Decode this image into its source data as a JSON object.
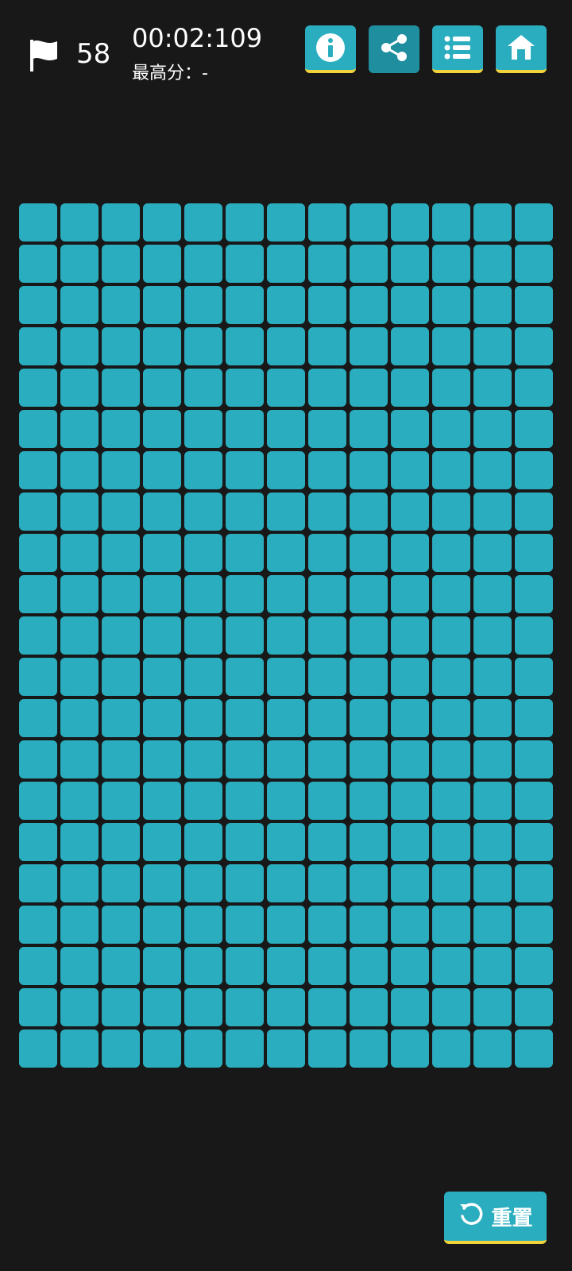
{
  "header": {
    "flag_count": "58",
    "timer": "00:02:109",
    "best_label": "最高分：",
    "best_value": "-"
  },
  "toolbar": {
    "buttons": [
      {
        "name": "info",
        "icon": "info-icon",
        "active": false
      },
      {
        "name": "share",
        "icon": "share-icon",
        "active": true
      },
      {
        "name": "list",
        "icon": "list-icon",
        "active": false
      },
      {
        "name": "home",
        "icon": "home-icon",
        "active": false
      }
    ]
  },
  "board": {
    "columns": 13,
    "rows": 21
  },
  "reset_button": {
    "label": "重置",
    "icon": "reset-icon"
  },
  "colors": {
    "background": "#181818",
    "tile": "#2aaebf",
    "tile_active": "#1f8fa0",
    "accent_underline": "#f2d43a",
    "text": "#ffffff"
  }
}
